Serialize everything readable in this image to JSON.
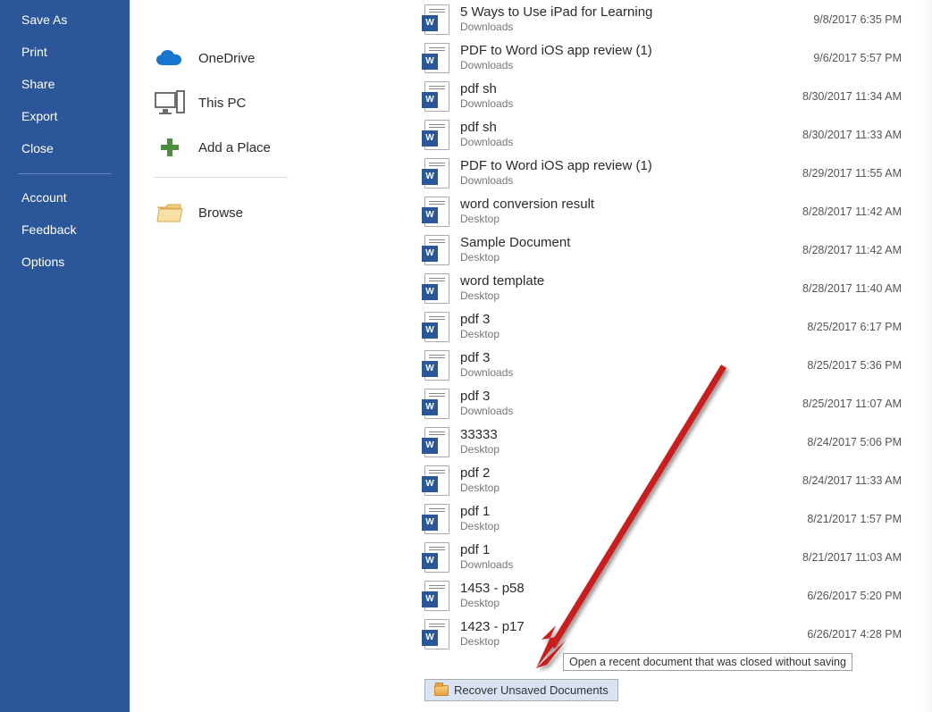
{
  "sidebar": {
    "items": [
      {
        "label": "Save As"
      },
      {
        "label": "Print"
      },
      {
        "label": "Share"
      },
      {
        "label": "Export"
      },
      {
        "label": "Close"
      }
    ],
    "items2": [
      {
        "label": "Account"
      },
      {
        "label": "Feedback"
      },
      {
        "label": "Options"
      }
    ]
  },
  "places": {
    "items": [
      {
        "label": "OneDrive",
        "icon": "cloud-icon"
      },
      {
        "label": "This PC",
        "icon": "pc-icon"
      },
      {
        "label": "Add a Place",
        "icon": "plus-icon"
      },
      {
        "label": "Browse",
        "icon": "folder-open-icon"
      }
    ]
  },
  "files": [
    {
      "name": "5 Ways to Use iPad for Learning",
      "loc": "Downloads",
      "date": "9/8/2017 6:35 PM"
    },
    {
      "name": "PDF to Word iOS app review (1)",
      "loc": "Downloads",
      "date": "9/6/2017 5:57 PM"
    },
    {
      "name": "pdf sh",
      "loc": "Downloads",
      "date": "8/30/2017 11:34 AM"
    },
    {
      "name": "pdf sh",
      "loc": "Downloads",
      "date": "8/30/2017 11:33 AM"
    },
    {
      "name": "PDF to Word iOS app review (1)",
      "loc": "Downloads",
      "date": "8/29/2017 11:55 AM"
    },
    {
      "name": "word conversion result",
      "loc": "Desktop",
      "date": "8/28/2017 11:42 AM"
    },
    {
      "name": "Sample Document",
      "loc": "Desktop",
      "date": "8/28/2017 11:42 AM"
    },
    {
      "name": "word template",
      "loc": "Desktop",
      "date": "8/28/2017 11:40 AM"
    },
    {
      "name": "pdf 3",
      "loc": "Desktop",
      "date": "8/25/2017 6:17 PM"
    },
    {
      "name": "pdf 3",
      "loc": "Downloads",
      "date": "8/25/2017 5:36 PM"
    },
    {
      "name": "pdf 3",
      "loc": "Downloads",
      "date": "8/25/2017 11:07 AM"
    },
    {
      "name": "33333",
      "loc": "Desktop",
      "date": "8/24/2017 5:06 PM"
    },
    {
      "name": "pdf 2",
      "loc": "Desktop",
      "date": "8/24/2017 11:33 AM"
    },
    {
      "name": "pdf 1",
      "loc": "Desktop",
      "date": "8/21/2017 1:57 PM"
    },
    {
      "name": "pdf 1",
      "loc": "Downloads",
      "date": "8/21/2017 11:03 AM"
    },
    {
      "name": "1453 - p58",
      "loc": "Desktop",
      "date": "6/26/2017 5:20 PM"
    },
    {
      "name": "1423 - p17",
      "loc": "Desktop",
      "date": "6/26/2017 4:28 PM"
    }
  ],
  "recover": {
    "label": "Recover Unsaved Documents"
  },
  "tooltip": {
    "text": "Open a recent document that was closed without saving"
  }
}
